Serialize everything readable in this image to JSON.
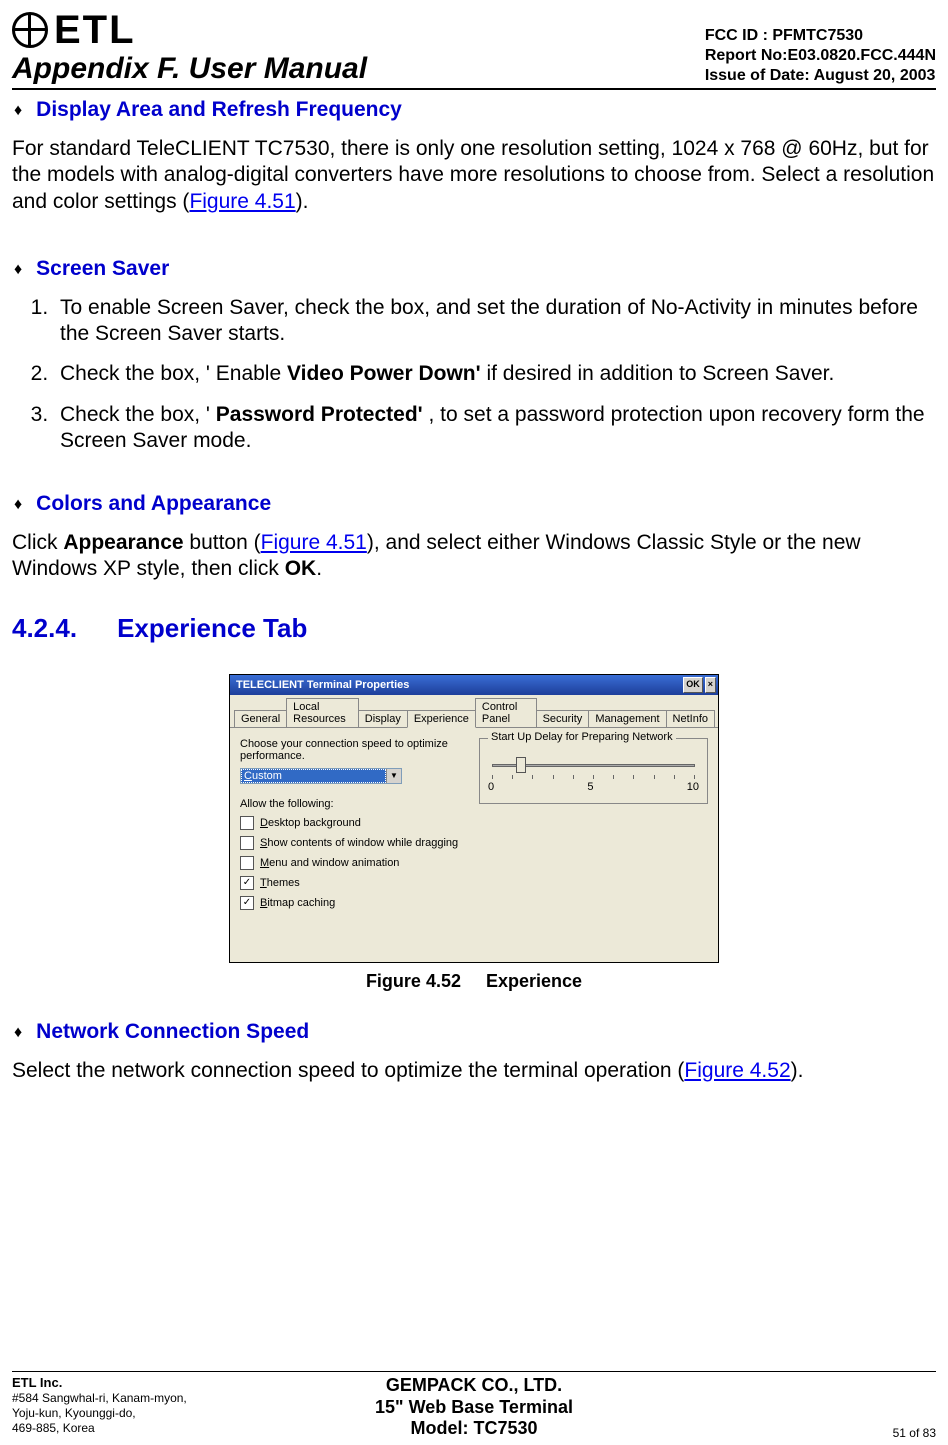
{
  "header": {
    "logo_text": "ETL",
    "appendix_title": "Appendix F. User Manual",
    "fcc_id": "FCC ID : PFMTC7530",
    "report_no": "Report No:E03.0820.FCC.444N",
    "issue_date": "Issue of Date: August 20, 2003"
  },
  "sections": {
    "display_area": {
      "title": "Display Area and Refresh Frequency",
      "para_before": "For standard TeleCLIENT TC7530, there is only one resolution setting, 1024 x 768 @ 60Hz, but for the models with analog-digital converters have more resolutions to choose from.  Select a resolution and color settings (",
      "link": "Figure 4.51",
      "para_after": ")."
    },
    "screen_saver": {
      "title": "Screen Saver",
      "step1": "To enable Screen Saver, check the box, and set the duration of No-Activity in minutes before the Screen Saver starts.",
      "step2_a": "Check the box, ' Enable ",
      "step2_b": "Video Power Down'",
      "step2_c": "  if desired in addition to Screen Saver.",
      "step3_a": "Check the box, ' ",
      "step3_b": "Password Protected'",
      "step3_c": " , to set a password protection upon recovery form the Screen Saver mode."
    },
    "colors": {
      "title": "Colors and Appearance",
      "a": "Click ",
      "b": "Appearance",
      "c": " button (",
      "link": "Figure 4.51",
      "d": "), and select either Windows Classic Style or the new Windows XP style, then click ",
      "e": "OK",
      "f": "."
    },
    "experience": {
      "num": "4.2.4.",
      "title": "Experience Tab"
    },
    "network": {
      "title": "Network Connection Speed",
      "a": "Select the network connection speed to optimize the terminal operation (",
      "link": "Figure 4.52",
      "b": ")."
    }
  },
  "dialog": {
    "title": "TELECLIENT Terminal Properties",
    "ok": "OK",
    "close": "×",
    "tabs": [
      "General",
      "Local Resources",
      "Display",
      "Experience",
      "Control Panel",
      "Security",
      "Management",
      "NetInfo"
    ],
    "active_tab_index": 3,
    "left": {
      "prompt": "Choose your connection speed to optimize performance.",
      "dropdown_value": "Custom",
      "allow_label": "Allow the following:",
      "options": [
        {
          "checked": false,
          "label": "Desktop background"
        },
        {
          "checked": false,
          "label": "Show contents of window while dragging"
        },
        {
          "checked": false,
          "label": "Menu and window animation"
        },
        {
          "checked": true,
          "label": "Themes"
        },
        {
          "checked": true,
          "label": "Bitmap caching"
        }
      ]
    },
    "right": {
      "legend": "Start Up Delay for Preparing Network",
      "scale_min": "0",
      "scale_mid": "5",
      "scale_max": "10"
    }
  },
  "figure_caption": "Figure 4.52     Experience",
  "footer": {
    "company": "ETL Inc.",
    "addr1": "#584 Sangwhal-ri, Kanam-myon,",
    "addr2": "Yoju-kun, Kyounggi-do,",
    "addr3": "469-885, Korea",
    "center1": "GEMPACK CO., LTD.",
    "center2": "15\" Web Base Terminal",
    "center3": "Model: TC7530",
    "page": "51 of 83"
  }
}
